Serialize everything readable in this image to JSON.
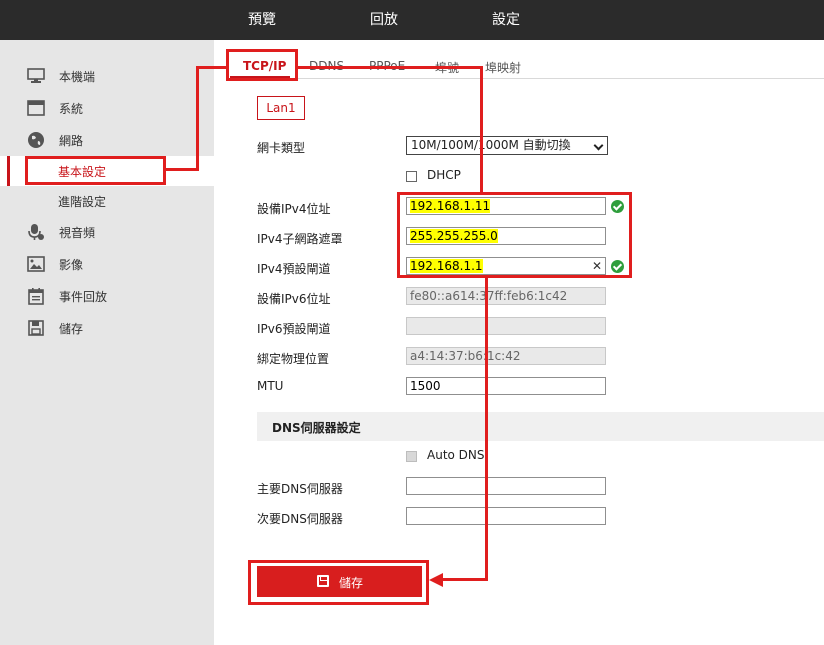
{
  "topnav": {
    "preview": "預覽",
    "playback": "回放",
    "settings": "設定"
  },
  "sidebar": {
    "items": [
      {
        "label": "本機端",
        "icon": "monitor-icon"
      },
      {
        "label": "系統",
        "icon": "window-icon"
      },
      {
        "label": "網路",
        "icon": "globe-icon"
      },
      {
        "label": "基本設定"
      },
      {
        "label": "進階設定"
      },
      {
        "label": "視音頻",
        "icon": "microphone-icon"
      },
      {
        "label": "影像",
        "icon": "image-icon"
      },
      {
        "label": "事件回放",
        "icon": "calendar-icon"
      },
      {
        "label": "儲存",
        "icon": "save-icon"
      }
    ]
  },
  "tabs": [
    "TCP/IP",
    "DDNS",
    "PPPoE",
    "埠號",
    "埠映射"
  ],
  "lan_button": "Lan1",
  "form": {
    "nic_type_label": "網卡類型",
    "nic_type_value": "10M/100M/1000M 自動切換",
    "dhcp_label": "DHCP",
    "ipv4_addr_label": "設備IPv4位址",
    "ipv4_addr_value": "192.168.1.11",
    "ipv4_mask_label": "IPv4子網路遮罩",
    "ipv4_mask_value": "255.255.255.0",
    "ipv4_gw_label": "IPv4預設閘道",
    "ipv4_gw_value": "192.168.1.1",
    "ipv6_addr_label": "設備IPv6位址",
    "ipv6_addr_value": "fe80::a614:37ff:feb6:1c42",
    "ipv6_gw_label": "IPv6預設閘道",
    "ipv6_gw_value": "",
    "mac_label": "綁定物理位置",
    "mac_value": "a4:14:37:b6:1c:42",
    "mtu_label": "MTU",
    "mtu_value": "1500"
  },
  "dns": {
    "section_title": "DNS伺服器設定",
    "auto_dns_label": "Auto DNS",
    "primary_label": "主要DNS伺服器",
    "primary_value": "",
    "secondary_label": "次要DNS伺服器",
    "secondary_value": ""
  },
  "save_button": "儲存",
  "colors": {
    "accent": "#c8141a",
    "annotation": "#e01e1e",
    "highlight": "#ffff00",
    "ok": "#2f9e3c"
  }
}
